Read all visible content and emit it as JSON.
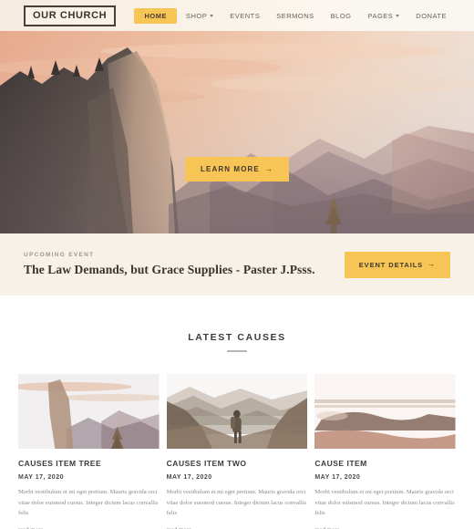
{
  "header": {
    "logo": "OUR CHURCH",
    "nav": [
      {
        "label": "HOME",
        "active": true,
        "caret": false
      },
      {
        "label": "SHOP",
        "active": false,
        "caret": true
      },
      {
        "label": "EVENTS",
        "active": false,
        "caret": false
      },
      {
        "label": "SERMONS",
        "active": false,
        "caret": false
      },
      {
        "label": "BLOG",
        "active": false,
        "caret": false
      },
      {
        "label": "PAGES",
        "active": false,
        "caret": true
      },
      {
        "label": "DONATE",
        "active": false,
        "caret": false
      }
    ]
  },
  "hero": {
    "cta_label": "LEARN MORE",
    "cta_arrow": "→",
    "image_alt": "sunset-mountain-valley"
  },
  "event": {
    "kicker": "UPCOMING EVENT",
    "title": "The Law Demands, but Grace Supplies - Paster J.Psss.",
    "button_label": "EVENT DETAILS",
    "button_arrow": "→"
  },
  "causes": {
    "section_title": "LATEST CAUSES",
    "read_more_label": "read more",
    "read_more_arrow": "→",
    "items": [
      {
        "title": "CAUSES ITEM TREE",
        "date": "MAY 17, 2020",
        "excerpt": "Morbi vestibulum et mi eget pretium. Mauris gravida orci vitae dolor euismod cursus. Integer dictum lacus convallis felis",
        "image_alt": "sunset-cliff-valley"
      },
      {
        "title": "CAUSES ITEM TWO",
        "date": "MAY 17, 2020",
        "excerpt": "Morbi vestibulum et mi eget pretium. Mauris gravida orci vitae dolor euismod cursus. Integer dictum lacus convallis felis",
        "image_alt": "hiker-in-valley"
      },
      {
        "title": "CAUSE ITEM",
        "date": "MAY 17, 2020",
        "excerpt": "Morbi vestibulum et mi eget pretium. Mauris gravida orci vitae dolor euismod cursus. Integer dictum lacus convallis felis",
        "image_alt": "hazy-desert-plateau"
      }
    ]
  },
  "colors": {
    "accent": "#f7c456",
    "header_bg": "#f8f1e6",
    "band_bg": "#f7f1e7",
    "text_dark": "#3b322c",
    "text_muted": "#8d8a88"
  }
}
